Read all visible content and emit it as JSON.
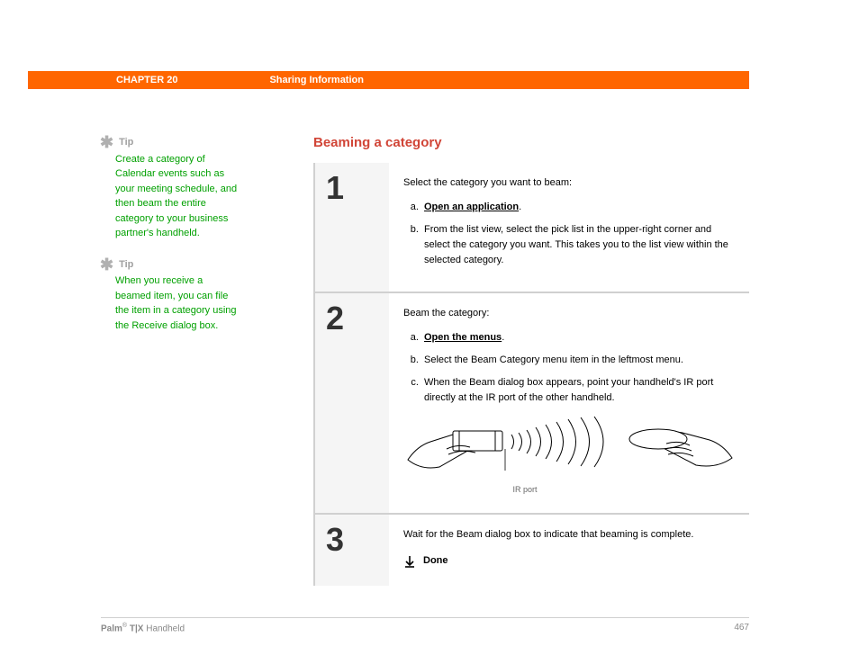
{
  "header": {
    "chapter": "CHAPTER 20",
    "section": "Sharing Information"
  },
  "sidebar": {
    "tips": [
      {
        "label": "Tip",
        "text": "Create a category of Calendar events such as your meeting schedule, and then beam the entire category to your business partner's handheld."
      },
      {
        "label": "Tip",
        "text": "When you receive a beamed item, you can file the item in a category using the Receive dialog box."
      }
    ]
  },
  "main": {
    "title": "Beaming a category",
    "steps": [
      {
        "number": "1",
        "intro": "Select the category you want to beam:",
        "items": [
          {
            "pre": "",
            "link": "Open an application",
            "post": "."
          },
          {
            "pre": "From the list view, select the pick list in the upper-right corner and select the category you want. This takes you to the list view within the selected category.",
            "link": "",
            "post": ""
          }
        ]
      },
      {
        "number": "2",
        "intro": "Beam the category:",
        "items": [
          {
            "pre": "",
            "link": "Open the menus",
            "post": "."
          },
          {
            "pre": "Select the Beam Category menu item in the leftmost menu.",
            "link": "",
            "post": ""
          },
          {
            "pre": "When the Beam dialog box appears, point your handheld's IR port directly at the IR port of the other handheld.",
            "link": "",
            "post": ""
          }
        ],
        "ir_label": "IR port"
      },
      {
        "number": "3",
        "intro": "Wait for the Beam dialog box to indicate that beaming is complete.",
        "done": "Done"
      }
    ]
  },
  "footer": {
    "brand_strong": "Palm",
    "reg": "®",
    "model_strong": " T|X",
    "suffix": " Handheld",
    "page": "467"
  }
}
